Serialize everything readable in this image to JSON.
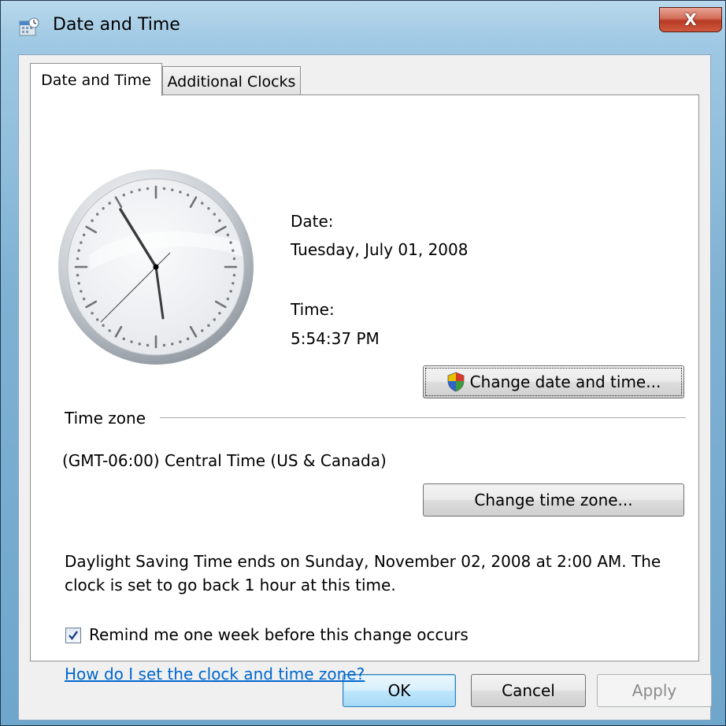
{
  "window": {
    "title": "Date and Time",
    "close_glyph": "X"
  },
  "tabs": [
    {
      "label": "Date and Time",
      "active": true
    },
    {
      "label": "Additional Clocks",
      "active": false
    }
  ],
  "date": {
    "label": "Date:",
    "value": "Tuesday, July 01, 2008"
  },
  "time": {
    "label": "Time:",
    "value": "5:54:37 PM"
  },
  "buttons": {
    "change_date_time": "Change date and time...",
    "change_time_zone": "Change time zone...",
    "ok": "OK",
    "cancel": "Cancel",
    "apply": "Apply"
  },
  "time_zone": {
    "heading": "Time zone",
    "value": "(GMT-06:00) Central Time (US & Canada)"
  },
  "dst": {
    "line1": "Daylight Saving Time ends on Sunday, November 02, 2008 at 2:00 AM. The",
    "line2": "clock is set to go back 1 hour at this time."
  },
  "reminder": {
    "label": "Remind me one week before this change occurs",
    "checked": true
  },
  "help_link": "How do I set the clock and time zone?",
  "icons": {
    "title": "date-time-icon",
    "shield": "uac-shield-icon",
    "clock": "analog-clock-icon"
  },
  "colors": {
    "link": "#0066cc",
    "close_button": "#c84e36",
    "ok_button": "#bee6fd"
  }
}
